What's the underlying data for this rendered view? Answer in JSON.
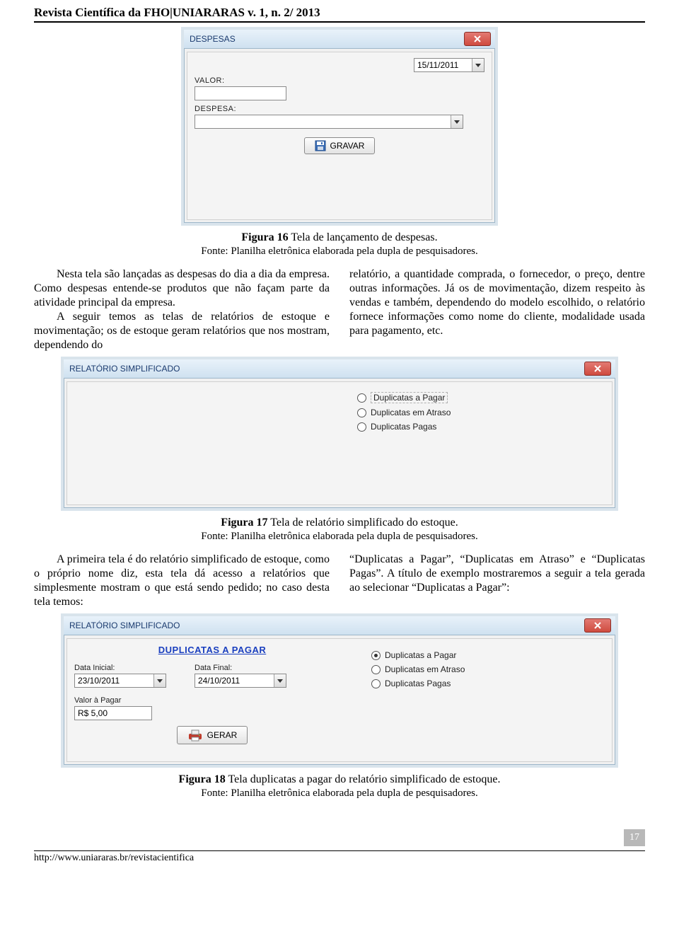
{
  "journal_header": "Revista Científica da FHO|UNIARARAS v. 1, n. 2/ 2013",
  "fig16": {
    "title": {
      "title": "DESPESAS"
    },
    "date": {
      "value": "15/11/2011"
    },
    "labels": {
      "valor": "VALOR:",
      "despesa": "DESPESA:"
    },
    "button": "GRAVAR",
    "caption_bold": "Figura 16",
    "caption_rest": "  Tela de lançamento de despesas.",
    "source": "Fonte: Planilha eletrônica elaborada pela dupla de pesquisadores."
  },
  "para1": {
    "col1_p1": "Nesta tela são lançadas as despesas do dia a dia da empresa. Como despesas entende-se produtos que não façam parte da atividade principal da empresa.",
    "col1_p2": "A seguir temos as telas de relatórios de estoque e movimentação; os de estoque geram relatórios que nos mostram, dependendo do",
    "col2_p1": "relatório, a quantidade comprada, o fornecedor, o preço, dentre outras informações. Já os de movimentação, dizem respeito às vendas e também, dependendo do modelo escolhido, o relatório fornece informações como nome do cliente, modalidade usada para pagamento, etc."
  },
  "fig17": {
    "title": {
      "title": "RELATÓRIO SIMPLIFICADO"
    },
    "options": {
      "pagar": "Duplicatas a Pagar",
      "atraso": "Duplicatas em Atraso",
      "pagas": "Duplicatas Pagas"
    },
    "caption_bold": "Figura 17",
    "caption_rest": " Tela de relatório simplificado do estoque.",
    "source": "Fonte: Planilha eletrônica elaborada pela dupla de pesquisadores."
  },
  "para2": {
    "col1_p1": "A primeira tela é do relatório simplificado de estoque, como o próprio nome diz, esta tela dá acesso a relatórios que simplesmente mostram o que está sendo pedido; no caso desta tela temos:",
    "col2_p1": "“Duplicatas a Pagar”, “Duplicatas em Atraso” e “Duplicatas Pagas”. A título de exemplo mostraremos a seguir a tela gerada ao selecionar “Duplicatas a Pagar”:"
  },
  "fig18": {
    "title": {
      "title": "RELATÓRIO SIMPLIFICADO"
    },
    "heading": "DUPLICATAS A PAGAR",
    "labels": {
      "data_inicial": "Data Inicial:",
      "data_final": "Data Final:",
      "valor_pagar": "Valor à Pagar"
    },
    "values": {
      "data_inicial": "23/10/2011",
      "data_final": "24/10/2011",
      "valor_pagar": "R$ 5,00"
    },
    "options": {
      "pagar": "Duplicatas a Pagar",
      "atraso": "Duplicatas em Atraso",
      "pagas": "Duplicatas Pagas"
    },
    "button": "GERAR",
    "caption_bold": "Figura 18",
    "caption_rest": " Tela duplicatas a pagar do relatório simplificado de estoque.",
    "source": "Fonte: Planilha eletrônica elaborada pela dupla de pesquisadores."
  },
  "page_number": "17",
  "footer_url": "http://www.uniararas.br/revistacientifica"
}
